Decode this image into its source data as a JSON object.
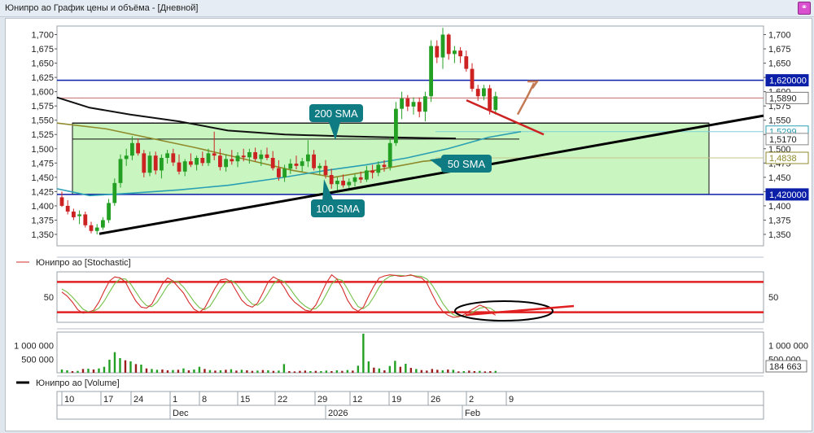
{
  "window": {
    "title": "Юнипро ао График цены и объёма - [Дневной]",
    "link_icon": "link-icon"
  },
  "colors": {
    "up": "#23a023",
    "down": "#cc2222",
    "level": "#0b1fa8",
    "box_fill": "#c8f5c0",
    "sma200": "#111111",
    "sma100": "#8f8a2b",
    "sma50": "#2a9fb3",
    "callout": "#0f7c83",
    "stoch_k": "#d62b2b",
    "stoch_d": "#74c04a",
    "volume_up": "#23a023",
    "volume_down": "#9b1d1d"
  },
  "chart_data": [
    {
      "type": "candlestick",
      "panel": "price",
      "ylim": [
        1330,
        1715
      ],
      "y_ticks": [
        "1,700",
        "1,675",
        "1,650",
        "1,625",
        "1,600",
        "1,575",
        "1,550",
        "1,525",
        "1,500",
        "1,475",
        "1,450",
        "1,425",
        "1,400",
        "1,375",
        "1,350"
      ],
      "candles": [
        [
          1415,
          1425,
          1398,
          1400
        ],
        [
          1400,
          1410,
          1385,
          1390
        ],
        [
          1390,
          1395,
          1375,
          1380
        ],
        [
          1382,
          1392,
          1368,
          1385
        ],
        [
          1385,
          1390,
          1362,
          1366
        ],
        [
          1366,
          1372,
          1352,
          1356
        ],
        [
          1356,
          1368,
          1350,
          1362
        ],
        [
          1362,
          1380,
          1358,
          1375
        ],
        [
          1375,
          1412,
          1370,
          1405
        ],
        [
          1405,
          1448,
          1400,
          1440
        ],
        [
          1440,
          1490,
          1432,
          1482
        ],
        [
          1482,
          1500,
          1470,
          1488
        ],
        [
          1488,
          1522,
          1480,
          1510
        ],
        [
          1510,
          1518,
          1488,
          1492
        ],
        [
          1492,
          1498,
          1450,
          1458
        ],
        [
          1458,
          1495,
          1452,
          1488
        ],
        [
          1488,
          1495,
          1455,
          1462
        ],
        [
          1462,
          1490,
          1448,
          1484
        ],
        [
          1484,
          1498,
          1474,
          1492
        ],
        [
          1492,
          1500,
          1470,
          1476
        ],
        [
          1476,
          1490,
          1455,
          1460
        ],
        [
          1460,
          1482,
          1452,
          1478
        ],
        [
          1478,
          1492,
          1468,
          1472
        ],
        [
          1472,
          1488,
          1462,
          1484
        ],
        [
          1484,
          1495,
          1470,
          1475
        ],
        [
          1475,
          1500,
          1470,
          1492
        ],
        [
          1492,
          1530,
          1480,
          1488
        ],
        [
          1488,
          1500,
          1462,
          1468
        ],
        [
          1468,
          1490,
          1460,
          1482
        ],
        [
          1482,
          1498,
          1472,
          1478
        ],
        [
          1478,
          1494,
          1468,
          1488
        ],
        [
          1488,
          1500,
          1478,
          1485
        ],
        [
          1485,
          1500,
          1474,
          1494
        ],
        [
          1494,
          1502,
          1478,
          1482
        ],
        [
          1482,
          1498,
          1470,
          1490
        ],
        [
          1490,
          1502,
          1480,
          1484
        ],
        [
          1484,
          1496,
          1462,
          1466
        ],
        [
          1466,
          1480,
          1444,
          1450
        ],
        [
          1450,
          1472,
          1442,
          1465
        ],
        [
          1465,
          1482,
          1456,
          1474
        ],
        [
          1474,
          1488,
          1464,
          1470
        ],
        [
          1470,
          1484,
          1460,
          1478
        ],
        [
          1478,
          1515,
          1468,
          1490
        ],
        [
          1490,
          1498,
          1462,
          1466
        ],
        [
          1466,
          1475,
          1455,
          1470
        ],
        [
          1470,
          1480,
          1448,
          1454
        ],
        [
          1454,
          1465,
          1430,
          1438
        ],
        [
          1438,
          1450,
          1426,
          1444
        ],
        [
          1444,
          1455,
          1432,
          1436
        ],
        [
          1436,
          1448,
          1428,
          1442
        ],
        [
          1442,
          1456,
          1434,
          1450
        ],
        [
          1450,
          1460,
          1440,
          1446
        ],
        [
          1446,
          1470,
          1442,
          1462
        ],
        [
          1462,
          1472,
          1448,
          1458
        ],
        [
          1458,
          1478,
          1452,
          1472
        ],
        [
          1472,
          1480,
          1460,
          1468
        ],
        [
          1468,
          1520,
          1462,
          1510
        ],
        [
          1510,
          1582,
          1505,
          1570
        ],
        [
          1570,
          1600,
          1552,
          1588
        ],
        [
          1588,
          1594,
          1566,
          1574
        ],
        [
          1574,
          1590,
          1560,
          1582
        ],
        [
          1582,
          1590,
          1555,
          1565
        ],
        [
          1565,
          1600,
          1548,
          1592
        ],
        [
          1592,
          1690,
          1582,
          1680
        ],
        [
          1680,
          1690,
          1650,
          1660
        ],
        [
          1660,
          1712,
          1640,
          1700
        ],
        [
          1700,
          1702,
          1656,
          1666
        ],
        [
          1666,
          1680,
          1650,
          1672
        ],
        [
          1672,
          1678,
          1650,
          1662
        ],
        [
          1662,
          1672,
          1635,
          1640
        ],
        [
          1640,
          1650,
          1600,
          1605
        ],
        [
          1605,
          1612,
          1584,
          1592
        ],
        [
          1592,
          1612,
          1585,
          1606
        ],
        [
          1606,
          1612,
          1560,
          1568
        ],
        [
          1568,
          1600,
          1560,
          1592
        ]
      ],
      "levels": [
        {
          "label": "1,620000",
          "value": 1620
        },
        {
          "label": "1,420000",
          "value": 1420
        }
      ],
      "extra_tags": [
        {
          "label": "1,5890",
          "value": 1589
        },
        {
          "label": "1,5299",
          "value": 1530
        },
        {
          "label": "1,5170",
          "value": 1517
        },
        {
          "label": "1,4838",
          "value": 1484
        }
      ],
      "annotations": {
        "sma200": "200 SMA",
        "sma100": "100 SMA",
        "sma50": "50 SMA"
      }
    },
    {
      "type": "line",
      "panel": "stochastic",
      "legend": "Юнипро ао [Stochastic]",
      "ylim": [
        0,
        100
      ],
      "y_ticks": [
        "50"
      ],
      "k": [
        60,
        52,
        40,
        25,
        18,
        20,
        24,
        40,
        62,
        82,
        90,
        88,
        80,
        60,
        42,
        30,
        28,
        36,
        56,
        76,
        88,
        82,
        70,
        58,
        40,
        26,
        20,
        28,
        48,
        68,
        84,
        86,
        80,
        62,
        44,
        34,
        30,
        38,
        58,
        80,
        90,
        84,
        70,
        52,
        40,
        32,
        24,
        22,
        34,
        56,
        78,
        94,
        86,
        68,
        44,
        28,
        22,
        30,
        52,
        72,
        88,
        92,
        94,
        93,
        91,
        92,
        94,
        90,
        88,
        78,
        56,
        36,
        22,
        14,
        10,
        11,
        15,
        22,
        28,
        34,
        30,
        20,
        14
      ],
      "d": [
        66,
        60,
        50,
        38,
        26,
        21,
        22,
        28,
        42,
        60,
        77,
        86,
        86,
        76,
        60,
        44,
        33,
        31,
        40,
        56,
        73,
        82,
        80,
        70,
        56,
        41,
        29,
        25,
        32,
        48,
        66,
        79,
        83,
        76,
        62,
        47,
        36,
        34,
        42,
        58,
        76,
        85,
        81,
        69,
        54,
        41,
        32,
        26,
        27,
        37,
        56,
        76,
        86,
        83,
        66,
        47,
        31,
        27,
        35,
        51,
        70,
        84,
        91,
        93,
        93,
        92,
        93,
        92,
        91,
        86,
        74,
        57,
        38,
        24,
        15,
        12,
        12,
        16,
        22,
        28,
        30,
        28,
        21
      ]
    },
    {
      "type": "bar",
      "panel": "volume",
      "legend": "Юнипро ао [Volume]",
      "y_ticks": [
        "1 000 000",
        "500 000"
      ],
      "current_volume": "184 663",
      "values": [
        [
          120000,
          1
        ],
        [
          90000,
          1
        ],
        [
          60000,
          0
        ],
        [
          70000,
          1
        ],
        [
          140000,
          0
        ],
        [
          150000,
          1
        ],
        [
          120000,
          0
        ],
        [
          160000,
          1
        ],
        [
          220000,
          1
        ],
        [
          480000,
          1
        ],
        [
          760000,
          1
        ],
        [
          540000,
          1
        ],
        [
          460000,
          0
        ],
        [
          420000,
          1
        ],
        [
          320000,
          0
        ],
        [
          300000,
          1
        ],
        [
          160000,
          0
        ],
        [
          140000,
          1
        ],
        [
          110000,
          1
        ],
        [
          120000,
          0
        ],
        [
          90000,
          0
        ],
        [
          100000,
          1
        ],
        [
          110000,
          0
        ],
        [
          160000,
          1
        ],
        [
          90000,
          0
        ],
        [
          120000,
          1
        ],
        [
          220000,
          1
        ],
        [
          140000,
          0
        ],
        [
          100000,
          1
        ],
        [
          80000,
          0
        ],
        [
          90000,
          1
        ],
        [
          110000,
          0
        ],
        [
          130000,
          1
        ],
        [
          80000,
          0
        ],
        [
          110000,
          1
        ],
        [
          90000,
          0
        ],
        [
          70000,
          0
        ],
        [
          80000,
          1
        ],
        [
          100000,
          0
        ],
        [
          90000,
          1
        ],
        [
          70000,
          0
        ],
        [
          80000,
          1
        ],
        [
          320000,
          1
        ],
        [
          60000,
          0
        ],
        [
          50000,
          0
        ],
        [
          70000,
          0
        ],
        [
          80000,
          0
        ],
        [
          60000,
          1
        ],
        [
          70000,
          0
        ],
        [
          60000,
          1
        ],
        [
          80000,
          1
        ],
        [
          60000,
          0
        ],
        [
          90000,
          1
        ],
        [
          70000,
          0
        ],
        [
          100000,
          1
        ],
        [
          80000,
          0
        ],
        [
          260000,
          1
        ],
        [
          1440000,
          1
        ],
        [
          420000,
          1
        ],
        [
          190000,
          0
        ],
        [
          160000,
          1
        ],
        [
          90000,
          0
        ],
        [
          250000,
          1
        ],
        [
          440000,
          1
        ],
        [
          220000,
          0
        ],
        [
          330000,
          1
        ],
        [
          180000,
          0
        ],
        [
          140000,
          1
        ],
        [
          100000,
          0
        ],
        [
          80000,
          0
        ],
        [
          140000,
          0
        ],
        [
          110000,
          0
        ],
        [
          90000,
          1
        ],
        [
          120000,
          0
        ],
        [
          110000,
          1
        ],
        [
          50000,
          0
        ],
        [
          60000,
          1
        ],
        [
          80000,
          0
        ],
        [
          60000,
          0
        ],
        [
          70000,
          1
        ],
        [
          50000,
          0
        ],
        [
          60000,
          0
        ],
        [
          70000,
          1
        ]
      ]
    }
  ],
  "time_axis": {
    "days": [
      "10",
      "17",
      "24",
      "1",
      "8",
      "15",
      "22",
      "29",
      "12",
      "19",
      "26",
      "2",
      "9"
    ],
    "months": [
      "Dec",
      "2026",
      "Feb"
    ]
  }
}
